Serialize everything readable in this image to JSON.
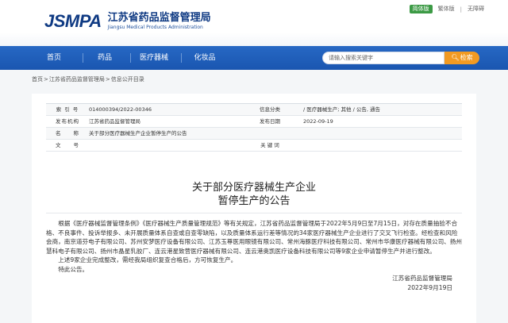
{
  "header": {
    "logo": "JSMPA",
    "title_cn": "江苏省药品监督管理局",
    "title_en": "Jiangsu Medical Products Administration",
    "lang_simplified": "简体版",
    "lang_traditional": "繁体版",
    "lang_sep": "|",
    "accessibility": "无障碍",
    "colors": {
      "brand": "#0f3a83",
      "lang_active": "#3c9a45"
    }
  },
  "nav": {
    "items": [
      "首页",
      "药品",
      "医疗器械",
      "化妆品"
    ],
    "search_placeholder": "请输入搜索关键字",
    "search_button": "检索",
    "colors": {
      "bar": "#1f5fbb",
      "search_btn": "#f29a22"
    }
  },
  "breadcrumb": {
    "items": [
      "首页",
      "江苏省药品监督管理局",
      "信息公开目录"
    ],
    "sep": ">"
  },
  "info": {
    "index_label": "索 引 号",
    "index_value": "014000394/2022-00346",
    "category_label": "信息分类",
    "category_value": "/ 医疗器械生产; 其他 / 公告, 通告",
    "issuer_label": "发布机构",
    "issuer_value": "江苏省药品监督管理局",
    "date_label": "发布日期",
    "date_value": "2022-09-19",
    "name_label": "名　　称",
    "name_value": "关于部分医疗器械生产企业暂停生产的公告",
    "docno_label": "文　　号",
    "keyword_label": "关 键 词"
  },
  "article": {
    "title_line1": "关于部分医疗器械生产企业",
    "title_line2": "暂停生产的公告",
    "para1": "根据《医疗器械监督管理条例》《医疗器械生产质量管理规范》等有关规定，江苏省药品监督管理局于2022年5月9日至7月15日，对存在质量抽验不合格、不良事件、投诉举报多、未开展质量体系自查或自查零缺陷，以及质量体系运行差等情况的34家医疗器械生产企业进行了交叉飞行检查。经检查和风险会商，南京道芬电子有限公司、苏州安梦医疗设备有限公司、江苏玉尊医用眼镜有限公司、常州海豚医疗科技有限公司、常州市华康医疗器械有限公司、扬州慧科电子有限公司、扬州市晶星乳胶厂、连云港星致营医疗器械有限公司、连云港奥凯医疗设备科技有限公司等9家企业申请暂停生产并进行整改。",
    "para2": "上述9家企业完成整改，需经我局组织复查合格后，方可恢复生产。",
    "para3": "特此公告。",
    "sign_org": "江苏省药品监督管理局",
    "sign_date": "2022年9月19日"
  }
}
